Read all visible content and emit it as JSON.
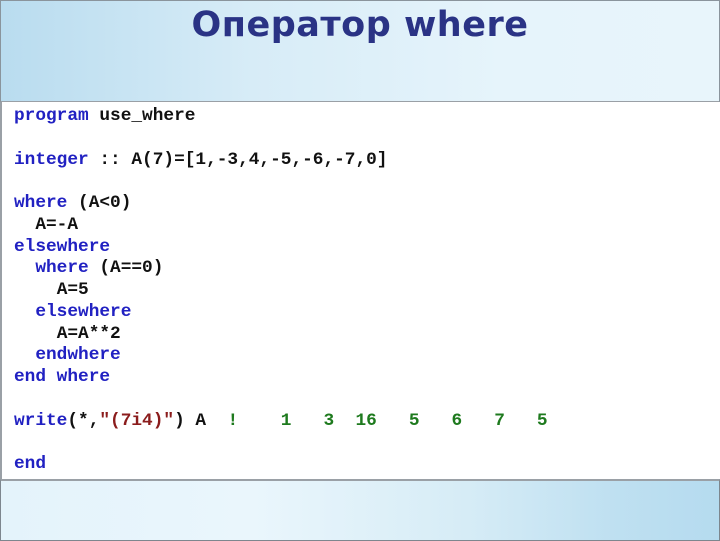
{
  "slide": {
    "title": "Оператор where"
  },
  "colors": {
    "title": "#2a3385",
    "keyword": "#2121c2",
    "string": "#8b1c1c",
    "comment": "#1e7a1e",
    "text": "#111111"
  },
  "code": {
    "lines": [
      {
        "kw": "program",
        "rest": " use_where"
      },
      {
        "blank": ""
      },
      {
        "kw": "integer",
        "rest": " :: A(7)=[1,-3,4,-5,-6,-7,0]"
      },
      {
        "blank": ""
      },
      {
        "kw": "where",
        "rest": " (A<0)"
      },
      {
        "indent": "  ",
        "rest": "A=-A"
      },
      {
        "kw": "elsewhere"
      },
      {
        "indent": "  ",
        "kw": "where",
        "rest": " (A==0)"
      },
      {
        "indent": "    ",
        "rest": "A=5"
      },
      {
        "indent": "  ",
        "kw": "elsewhere"
      },
      {
        "indent": "    ",
        "rest": "A=A**2"
      },
      {
        "indent": "  ",
        "kw": "endwhere"
      },
      {
        "kw": "end where"
      },
      {
        "blank": ""
      },
      {
        "kw": "write",
        "pre": "(*,",
        "str": "\"(7i4)\"",
        "rest": ") A  ",
        "comment": "!    1   3  16   5   6   7   5"
      },
      {
        "blank": ""
      },
      {
        "kw": "end"
      }
    ]
  },
  "output": {
    "format": "(7i4)",
    "values": [
      1,
      3,
      16,
      5,
      6,
      7,
      5
    ]
  }
}
